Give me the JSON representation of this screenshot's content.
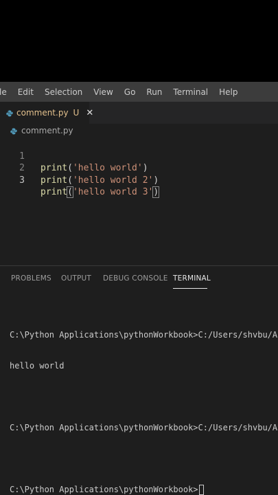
{
  "menu": [
    "le",
    "Edit",
    "Selection",
    "View",
    "Go",
    "Run",
    "Terminal",
    "Help"
  ],
  "tab": {
    "label": "comment.py",
    "status": "U",
    "close": "✕"
  },
  "breadcrumb": "comment.py",
  "editor": {
    "active_line": 3,
    "lines": [
      {
        "num": "1",
        "fn": "print",
        "open": "(",
        "str": "'hello world'",
        "close": ")"
      },
      {
        "num": "2",
        "fn": "print",
        "open": "(",
        "str": "'hello world 2'",
        "close": ")"
      },
      {
        "num": "3",
        "fn": "print",
        "open": "(",
        "str": "'hello world 3'",
        "close": ")"
      }
    ]
  },
  "panel": {
    "tabs": [
      "PROBLEMS",
      "OUTPUT",
      "DEBUG CONSOLE",
      "TERMINAL"
    ],
    "active_tab": "TERMINAL"
  },
  "terminal": {
    "lines": [
      "C:\\Python Applications\\pythonWorkbook>C:/Users/shvbu/AppData",
      "hello world",
      "",
      "C:\\Python Applications\\pythonWorkbook>C:/Users/shvbu/AppData",
      "",
      "C:\\Python Applications\\pythonWorkbook>"
    ]
  },
  "colors": {
    "menubar": "#3c3c3c",
    "editor_bg": "#1e1e1e",
    "string": "#ce9178",
    "function": "#dcdcaa",
    "modified": "#e2c08d",
    "python_icon_blue": "#519aba"
  }
}
